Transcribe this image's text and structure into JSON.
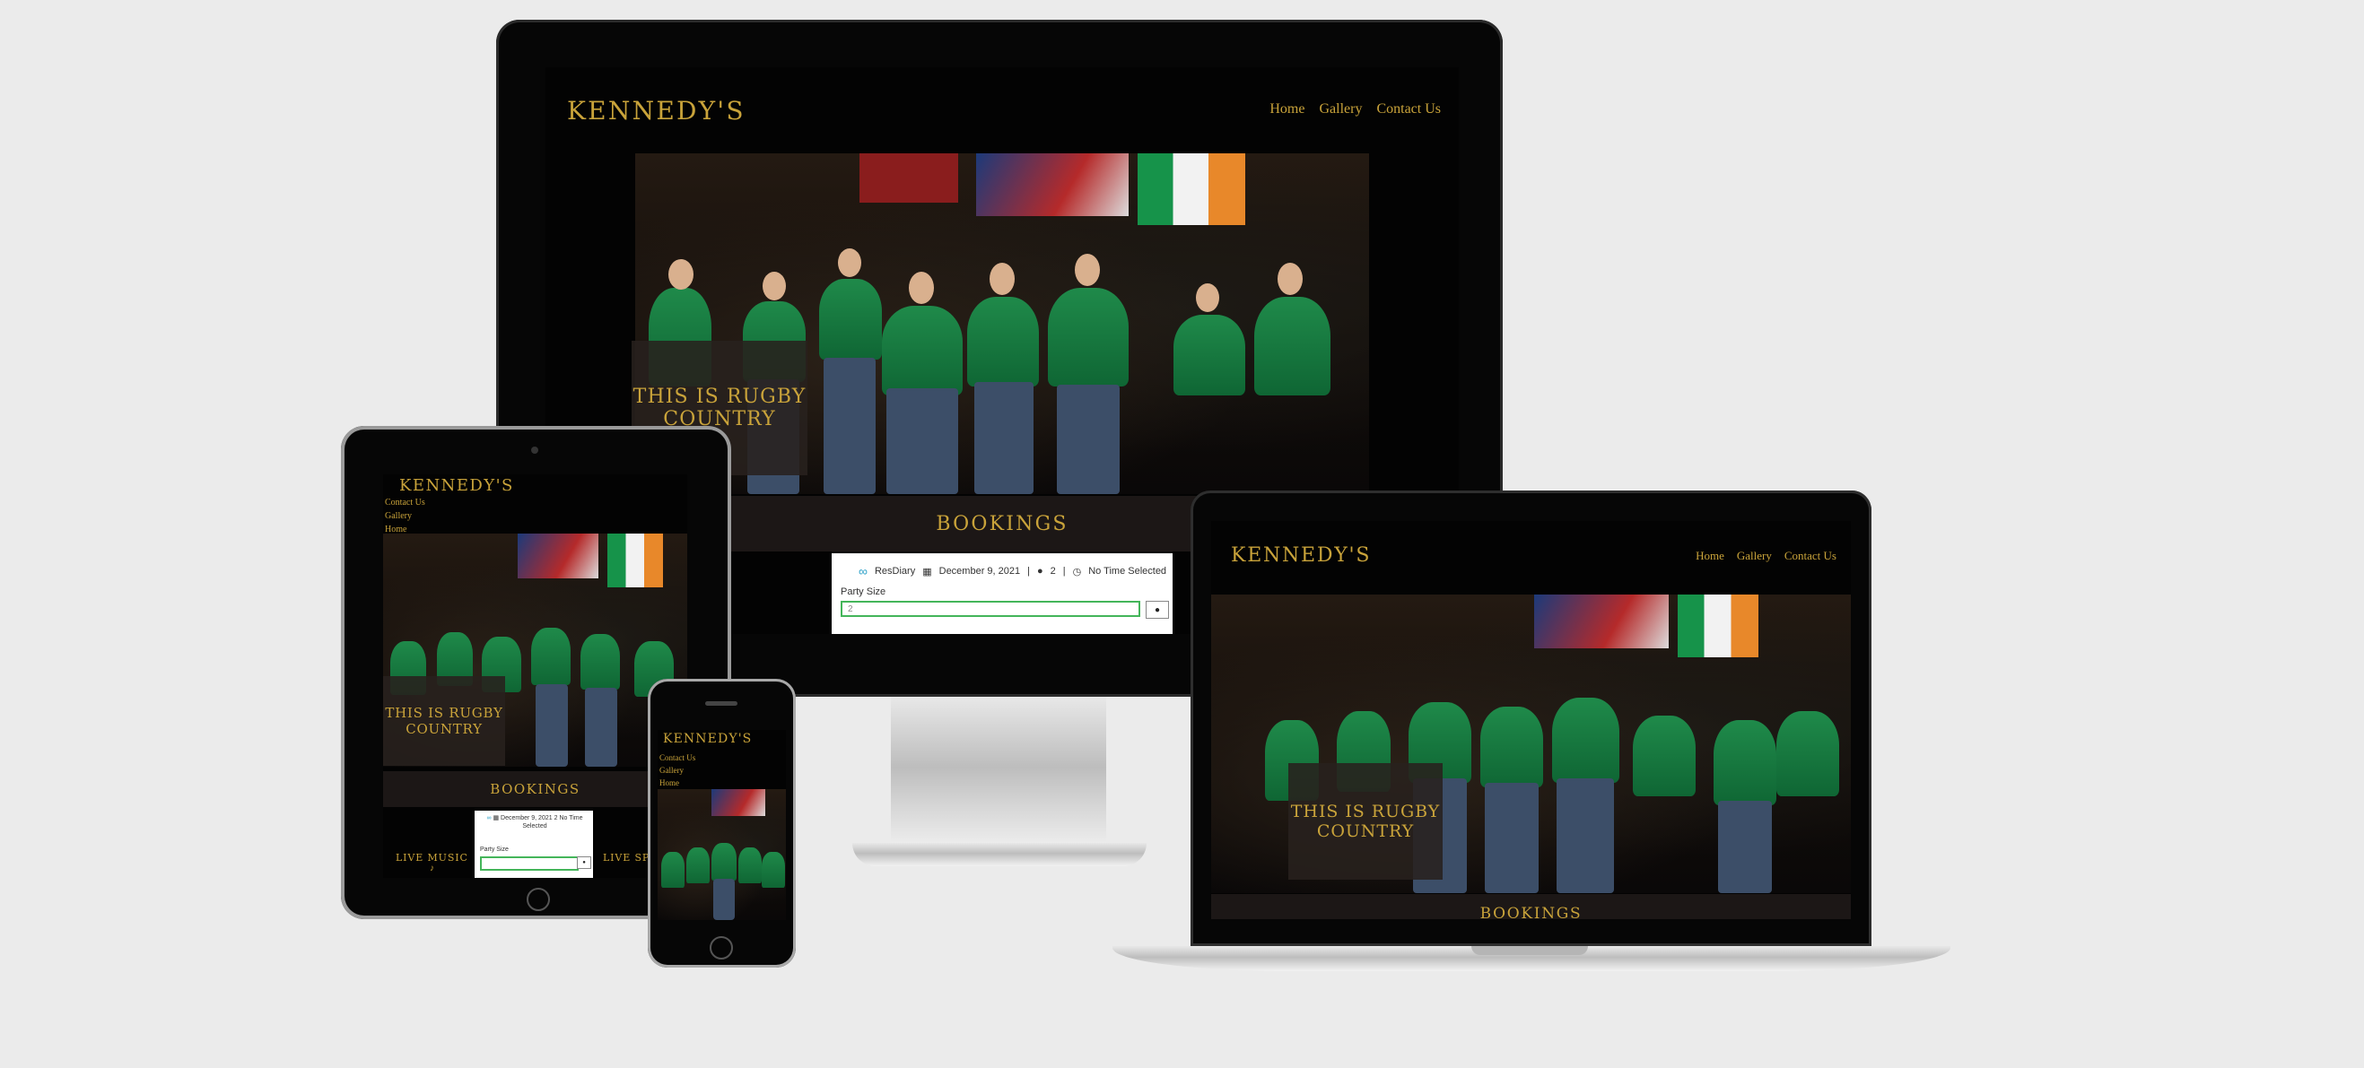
{
  "brand": "KENNEDY'S",
  "nav": {
    "home": "Home",
    "gallery": "Gallery",
    "contact": "Contact Us"
  },
  "hero": {
    "title_line1": "THIS IS RUGBY",
    "title_line2": "COUNTRY"
  },
  "bookings": {
    "heading": "BOOKINGS"
  },
  "widget": {
    "provider": "ResDiary",
    "date": "December 9, 2021",
    "party_count": "2",
    "time": "No Time Selected",
    "party_label": "Party Size",
    "party_value": "2"
  },
  "tablet": {
    "live_music": "LIVE MUSIC",
    "live_sport": "LIVE SP"
  },
  "colors": {
    "gold": "#c9a33a",
    "background": "#ebebeb",
    "green": "#44b55a"
  },
  "icons": [
    "calendar-icon",
    "person-icon",
    "clock-icon",
    "infinity-icon",
    "music-note-icon"
  ]
}
